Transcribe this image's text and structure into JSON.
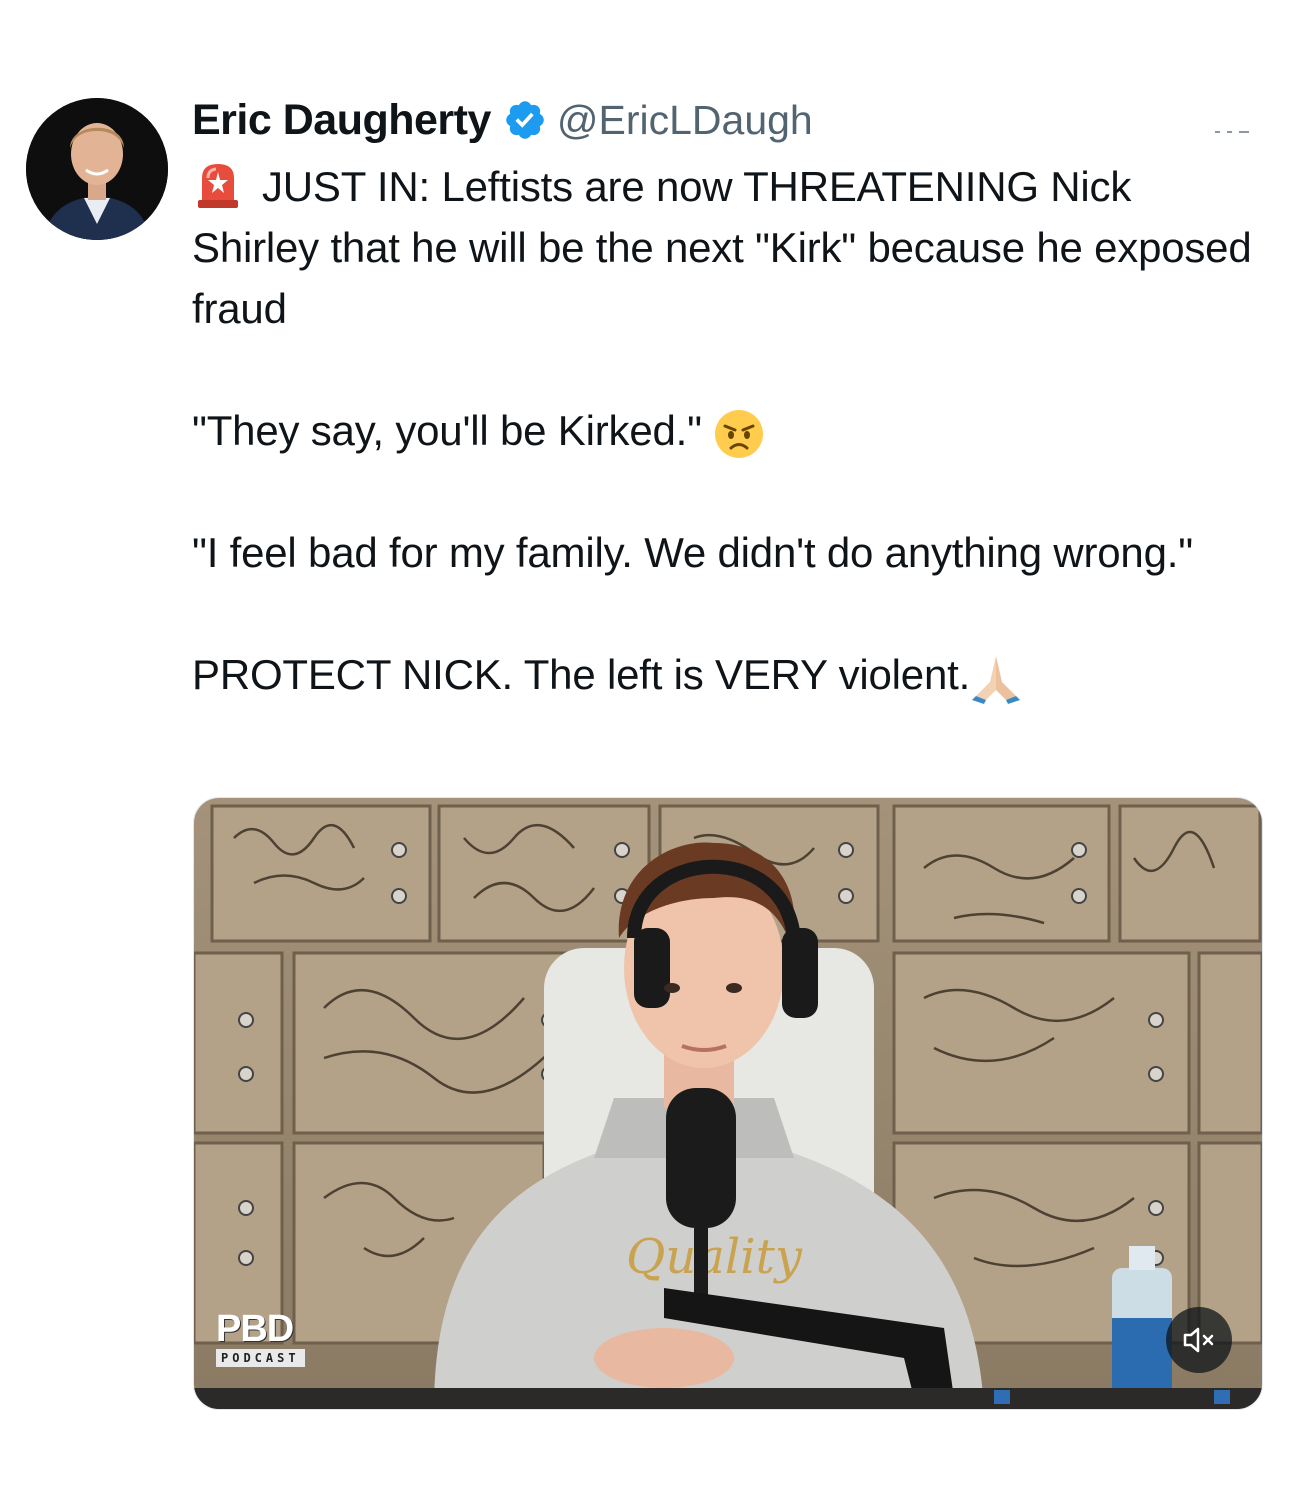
{
  "author": {
    "display_name": "Eric Daugherty",
    "handle": "@EricLDaugh",
    "verified": true,
    "verified_color": "#1d9bf0"
  },
  "tweet": {
    "line1": "JUST IN: Leftists are now THREATENING Nick Shirley that he will be the next \"Kirk\" because he exposed fraud",
    "quote1": "\"They say, you'll be Kirked.\"",
    "quote2": "\"I feel bad for my family. We didn't do anything wrong.\"",
    "closing": "PROTECT NICK. The left is VERY violent.",
    "icons": [
      "siren-icon",
      "angry-face-icon",
      "folded-hands-icon"
    ]
  },
  "media": {
    "type": "video",
    "logo_title": "PBD",
    "logo_subtitle": "PODCAST",
    "mute_icon": "speaker-muted-icon"
  },
  "colors": {
    "text": "#0f1419",
    "secondary": "#536471",
    "accent": "#1d9bf0"
  }
}
